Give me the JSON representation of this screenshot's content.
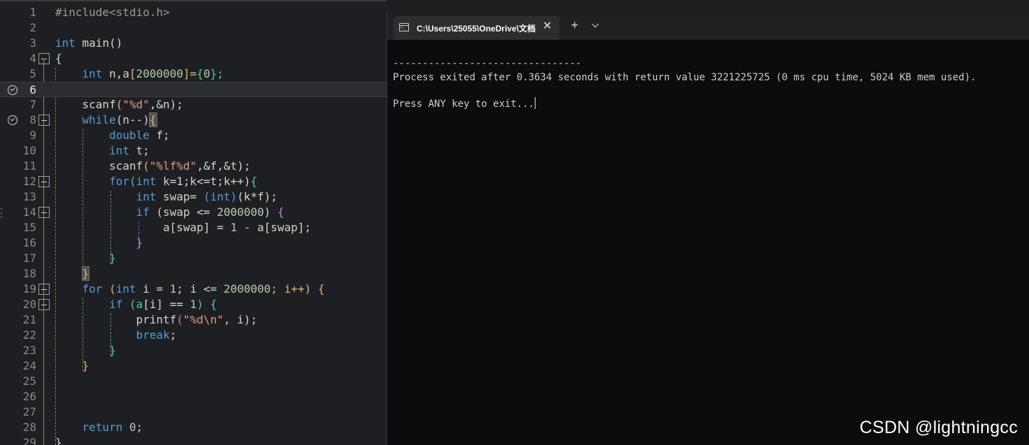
{
  "editor": {
    "lines": [
      {
        "n": "1",
        "breakpoint": false
      },
      {
        "n": "2",
        "breakpoint": false
      },
      {
        "n": "3",
        "breakpoint": false
      },
      {
        "n": "4",
        "breakpoint": false
      },
      {
        "n": "5",
        "breakpoint": false
      },
      {
        "n": "6",
        "breakpoint": true
      },
      {
        "n": "7",
        "breakpoint": false
      },
      {
        "n": "8",
        "breakpoint": true
      },
      {
        "n": "9",
        "breakpoint": false
      },
      {
        "n": "10",
        "breakpoint": false
      },
      {
        "n": "11",
        "breakpoint": false
      },
      {
        "n": "12",
        "breakpoint": false
      },
      {
        "n": "13",
        "breakpoint": false
      },
      {
        "n": "14",
        "breakpoint": false
      },
      {
        "n": "15",
        "breakpoint": false
      },
      {
        "n": "16",
        "breakpoint": false
      },
      {
        "n": "17",
        "breakpoint": false
      },
      {
        "n": "18",
        "breakpoint": false
      },
      {
        "n": "19",
        "breakpoint": false
      },
      {
        "n": "20",
        "breakpoint": false
      },
      {
        "n": "21",
        "breakpoint": false
      },
      {
        "n": "22",
        "breakpoint": false
      },
      {
        "n": "23",
        "breakpoint": false
      },
      {
        "n": "24",
        "breakpoint": false
      },
      {
        "n": "25",
        "breakpoint": false
      },
      {
        "n": "26",
        "breakpoint": false
      },
      {
        "n": "27",
        "breakpoint": false
      },
      {
        "n": "28",
        "breakpoint": false
      },
      {
        "n": "29",
        "breakpoint": false
      }
    ],
    "tokens": {
      "l1_a": "#include<stdio.h>",
      "l3_a": "int",
      "l3_b": " main()",
      "l4_a": "{",
      "l5_a": "int",
      "l5_b": " n,a",
      "l5_c": "[",
      "l5_d": "2000000",
      "l5_e": "]=",
      "l5_f": "{",
      "l5_g": "0",
      "l5_h": "};",
      "l7_a": "scanf",
      "l7_b": "(",
      "l7_c": "\"%d\"",
      "l7_d": ",&n);",
      "l8_a": "while",
      "l8_b": "(n--)",
      "l8_c": "{",
      "l9_a": "double",
      "l9_b": " f;",
      "l10_a": "int",
      "l10_b": " t;",
      "l11_a": "scanf",
      "l11_b": "(",
      "l11_c": "\"%lf%d\"",
      "l11_d": ",&f,&t);",
      "l12_a": "for",
      "l12_b": "(",
      "l12_c": "int",
      "l12_d": " k=1;k<=t;k++)",
      "l12_e": "{",
      "l13_a": "int",
      "l13_b": " swap= ",
      "l13_c": "(int)",
      "l13_d": "(k*f);",
      "l14_a": "if",
      "l14_b": " (swap <= ",
      "l14_c": "2000000",
      "l14_d": ") ",
      "l14_e": "{",
      "l15_a": "a",
      "l15_b": "[swap]",
      "l15_c": " = ",
      "l15_d": "1",
      "l15_e": " - a",
      "l15_f": "[swap]",
      "l15_g": ";",
      "l16_a": "}",
      "l17_a": "}",
      "l18_a": "}",
      "l19_a": "for",
      "l19_b": " (",
      "l19_c": "int",
      "l19_d": " i = ",
      "l19_e": "1",
      "l19_f": "; i <= ",
      "l19_g": "2000000",
      "l19_h": "; i++) ",
      "l19_i": "{",
      "l20_a": "if",
      "l20_b": " (a",
      "l20_c": "[i]",
      "l20_d": " == ",
      "l20_e": "1",
      "l20_f": ") ",
      "l20_g": "{",
      "l21_a": "printf",
      "l21_b": "(",
      "l21_c": "\"%d\\n\"",
      "l21_d": ", i);",
      "l22_a": "break",
      "l22_b": ";",
      "l23_a": "}",
      "l24_a": "}",
      "l28_a": "return",
      "l28_b": " ",
      "l28_c": "0",
      "l28_d": ";",
      "l29_a": "}"
    }
  },
  "terminal": {
    "tab_title": "C:\\Users\\25055\\OneDrive\\文档",
    "close_glyph": "✕",
    "new_tab_glyph": "+",
    "separator": "--------------------------------",
    "exit_line": "Process exited after 0.3634 seconds with return value 3221225725 (0 ms cpu time, 5024 KB mem used).",
    "prompt_line": "Press ANY key to exit..."
  },
  "watermark": "CSDN @lightningcc"
}
